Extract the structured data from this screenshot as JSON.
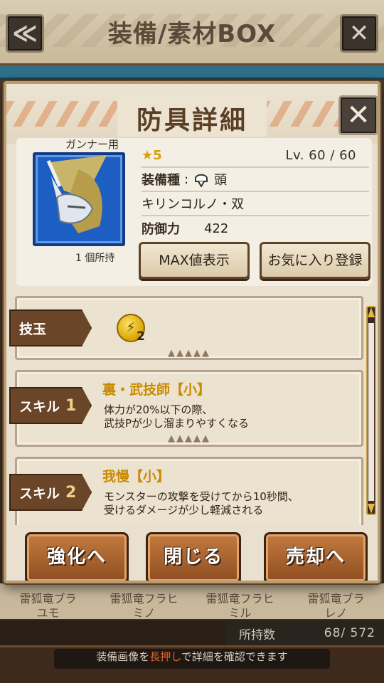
{
  "screen": {
    "title": "装備/素材BOX",
    "back_icon": "≪",
    "close_icon": "✕",
    "bg_items": [
      "雷狐竜ブラ\nユモ",
      "雷狐竜フラヒ\nミノ",
      "雷狐竜フラヒ\nミル",
      "雷狐竜ブラ\nレノ"
    ],
    "count_label": "所持数",
    "count_value": "68/ 572",
    "hint_pre": "装備画像を",
    "hint_hl": "長押し",
    "hint_post": "で詳細を確認できます"
  },
  "dialog": {
    "title": "防具詳細",
    "close_icon": "✕",
    "usage": "ガンナー用",
    "owned": "1 個所持",
    "rarity": "★5",
    "level": "Lv. 60 / 60",
    "equip_type_label": "装備種",
    "equip_type_value": "頭",
    "name": "キリンコルノ・双",
    "defense_label": "防御力",
    "defense_value": "422",
    "max_button": "MAX値表示",
    "fav_button": "お気に入り登録",
    "skills": [
      {
        "tag": "技玉",
        "num": "",
        "name": "",
        "desc": [
          "",
          ""
        ],
        "slot_level": "2",
        "slot_glyph": "⚡"
      },
      {
        "tag": "スキル",
        "num": "1",
        "name": "裏・武技師【小】",
        "desc": [
          "体力が20%以下の際、",
          "武技Pが少し溜まりやすくなる"
        ]
      },
      {
        "tag": "スキル",
        "num": "2",
        "name": "我慢【小】",
        "desc": [
          "モンスターの攻撃を受けてから10秒間、",
          "受けるダメージが少し軽減される"
        ]
      }
    ],
    "dots": "▲▲▲▲▲",
    "buttons": {
      "upgrade": "強化へ",
      "close": "閉じる",
      "sell": "売却へ"
    }
  }
}
